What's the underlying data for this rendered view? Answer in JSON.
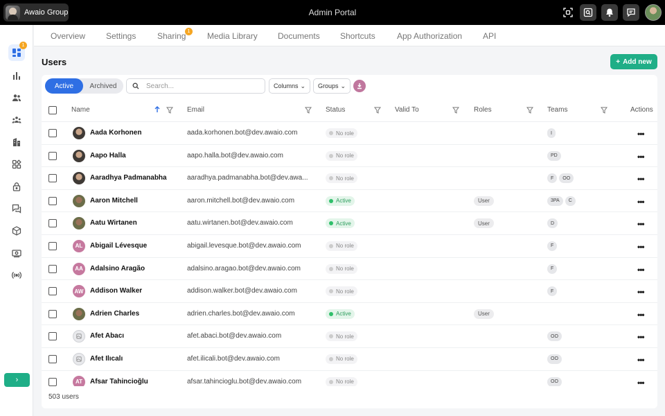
{
  "topbar": {
    "org_name": "Awaio Group",
    "title": "Admin Portal",
    "icons": [
      "qr-scan-icon",
      "screen-search-icon",
      "bell-icon",
      "chat-icon"
    ]
  },
  "sidebar": {
    "badge": "1",
    "items": [
      "dashboard",
      "analytics",
      "users",
      "groups",
      "organizations",
      "apps",
      "security",
      "messages",
      "packages",
      "billing",
      "broadcast"
    ],
    "expand_label": "›"
  },
  "tabs": {
    "items": [
      "Overview",
      "Settings",
      "Sharing",
      "Media Library",
      "Documents",
      "Shortcuts",
      "App Authorization",
      "API"
    ],
    "sharing_badge": "1"
  },
  "page": {
    "title": "Users",
    "add_label": "Add new"
  },
  "toolbar": {
    "active_label": "Active",
    "archived_label": "Archived",
    "search_placeholder": "Search...",
    "columns_label": "Columns",
    "groups_label": "Groups"
  },
  "table": {
    "headers": {
      "name": "Name",
      "email": "Email",
      "status": "Status",
      "valid_to": "Valid To",
      "roles": "Roles",
      "teams": "Teams",
      "actions": "Actions"
    },
    "rows": [
      {
        "avatar": "photo",
        "initials": "",
        "name": "Aada Korhonen",
        "email": "aada.korhonen.bot@dev.awaio.com",
        "status": "No role",
        "status_kind": "none",
        "role": "",
        "teams": [
          "I"
        ]
      },
      {
        "avatar": "photo",
        "initials": "",
        "name": "Aapo Halla",
        "email": "aapo.halla.bot@dev.awaio.com",
        "status": "No role",
        "status_kind": "none",
        "role": "",
        "teams": [
          "PD"
        ]
      },
      {
        "avatar": "photo",
        "initials": "",
        "name": "Aaradhya Padmanabha",
        "email": "aaradhya.padmanabha.bot@dev.awa...",
        "status": "No role",
        "status_kind": "none",
        "role": "",
        "teams": [
          "F",
          "OO"
        ]
      },
      {
        "avatar": "photo2",
        "initials": "",
        "name": "Aaron Mitchell",
        "email": "aaron.mitchell.bot@dev.awaio.com",
        "status": "Active",
        "status_kind": "active",
        "role": "User",
        "teams": [
          "3PA",
          "C"
        ]
      },
      {
        "avatar": "photo2",
        "initials": "",
        "name": "Aatu Wirtanen",
        "email": "aatu.wirtanen.bot@dev.awaio.com",
        "status": "Active",
        "status_kind": "active",
        "role": "User",
        "teams": [
          "D"
        ]
      },
      {
        "avatar": "initials",
        "initials": "AL",
        "name": "Abigail Lévesque",
        "email": "abigail.levesque.bot@dev.awaio.com",
        "status": "No role",
        "status_kind": "none",
        "role": "",
        "teams": [
          "F"
        ]
      },
      {
        "avatar": "initials",
        "initials": "AA",
        "name": "Adalsino Aragão",
        "email": "adalsino.aragao.bot@dev.awaio.com",
        "status": "No role",
        "status_kind": "none",
        "role": "",
        "teams": [
          "F"
        ]
      },
      {
        "avatar": "initials",
        "initials": "AW",
        "name": "Addison Walker",
        "email": "addison.walker.bot@dev.awaio.com",
        "status": "No role",
        "status_kind": "none",
        "role": "",
        "teams": [
          "F"
        ]
      },
      {
        "avatar": "photo2",
        "initials": "",
        "name": "Adrien Charles",
        "email": "adrien.charles.bot@dev.awaio.com",
        "status": "Active",
        "status_kind": "active",
        "role": "User",
        "teams": []
      },
      {
        "avatar": "img",
        "initials": "",
        "name": "Afet Abacı",
        "email": "afet.abaci.bot@dev.awaio.com",
        "status": "No role",
        "status_kind": "none",
        "role": "",
        "teams": [
          "OO"
        ]
      },
      {
        "avatar": "img",
        "initials": "",
        "name": "Afet Ilıcalı",
        "email": "afet.ilicali.bot@dev.awaio.com",
        "status": "No role",
        "status_kind": "none",
        "role": "",
        "teams": [
          "OO"
        ]
      },
      {
        "avatar": "initials",
        "initials": "AT",
        "name": "Afsar Tahincioğlu",
        "email": "afsar.tahincioglu.bot@dev.awaio.com",
        "status": "No role",
        "status_kind": "none",
        "role": "",
        "teams": [
          "OO"
        ]
      }
    ],
    "footer_count": "503 users"
  },
  "colors": {
    "accent_green": "#1fae87",
    "accent_blue": "#2f6fe4",
    "badge_orange": "#f5a623",
    "avatar_pink": "#c6799f"
  }
}
